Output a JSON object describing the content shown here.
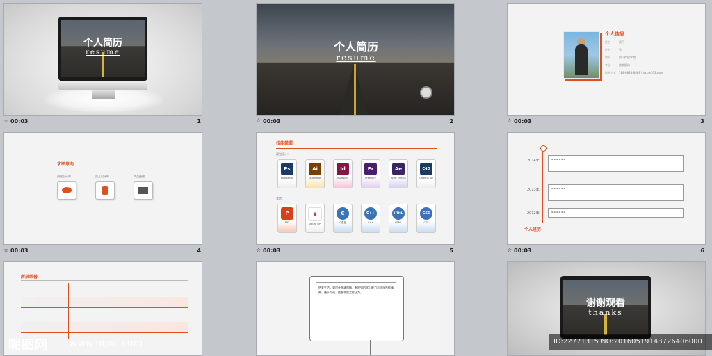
{
  "slides": [
    {
      "num": "1",
      "time": "00:03",
      "title_cn": "个人简历",
      "title_en": "resume"
    },
    {
      "num": "2",
      "time": "00:03",
      "title_cn": "个人简历",
      "title_en": "resume"
    },
    {
      "num": "3",
      "time": "00:03",
      "section": "个人信息",
      "rows": [
        {
          "k": "姓名",
          "v": "吴丹"
        },
        {
          "k": "性别",
          "v": "男"
        },
        {
          "k": "院校",
          "v": "四川传媒学院"
        },
        {
          "k": "专业",
          "v": "数字媒体"
        },
        {
          "k": "联系方式",
          "v": "188-8888-8888 | xxx@163.com"
        }
      ]
    },
    {
      "num": "4",
      "time": "00:03",
      "section": "求职意向",
      "items": [
        "视觉设计师",
        "交互设计师",
        "产品经理"
      ]
    },
    {
      "num": "5",
      "time": "00:03",
      "section": "技能掌握",
      "group1": "视觉设计：",
      "group2": "其他：",
      "software": [
        {
          "abbr": "Ps",
          "name": "Photoshop",
          "color": "#1a3a6b"
        },
        {
          "abbr": "Ai",
          "name": "Illustrator",
          "color": "#7a3e00"
        },
        {
          "abbr": "Id",
          "name": "InDesign",
          "color": "#8b1446"
        },
        {
          "abbr": "Pr",
          "name": "Premiere",
          "color": "#4a1e6e"
        },
        {
          "abbr": "Ae",
          "name": "After Effects",
          "color": "#3b2466"
        },
        {
          "abbr": "C4D",
          "name": "Cinema 4D",
          "color": "#1b3a62"
        }
      ],
      "other": [
        {
          "abbr": "P",
          "name": "PPT",
          "color": "#d7421b"
        },
        {
          "abbr": "▮",
          "name": "Axure RP",
          "color": "#ffffff"
        },
        {
          "abbr": "C",
          "name": "C语言",
          "color": "#3a73b8"
        },
        {
          "abbr": "C++",
          "name": "C++",
          "color": "#3a73b8"
        },
        {
          "abbr": "HTML",
          "name": "HTML",
          "color": "#3a73b8"
        },
        {
          "abbr": "CSS",
          "name": "CSS",
          "color": "#3a73b8"
        }
      ]
    },
    {
      "num": "6",
      "time": "00:03",
      "section": "个人经历",
      "years": [
        "2014年",
        "2013年",
        "2012年"
      ]
    },
    {
      "num": "",
      "time": "",
      "section": "所获荣誉"
    },
    {
      "num": "",
      "time": "",
      "text": "热爱生活，对设计充满热情，有较强的学习能力与团队合作精神，善于沟通，能够承受工作压力。"
    },
    {
      "num": "",
      "time": "",
      "title_cn": "谢谢观看",
      "title_en": "thanks"
    }
  ],
  "watermark": "昵图网",
  "watermark_url": "www.nipic.com",
  "image_id": "ID:22771315 NO:20160519143726406000"
}
